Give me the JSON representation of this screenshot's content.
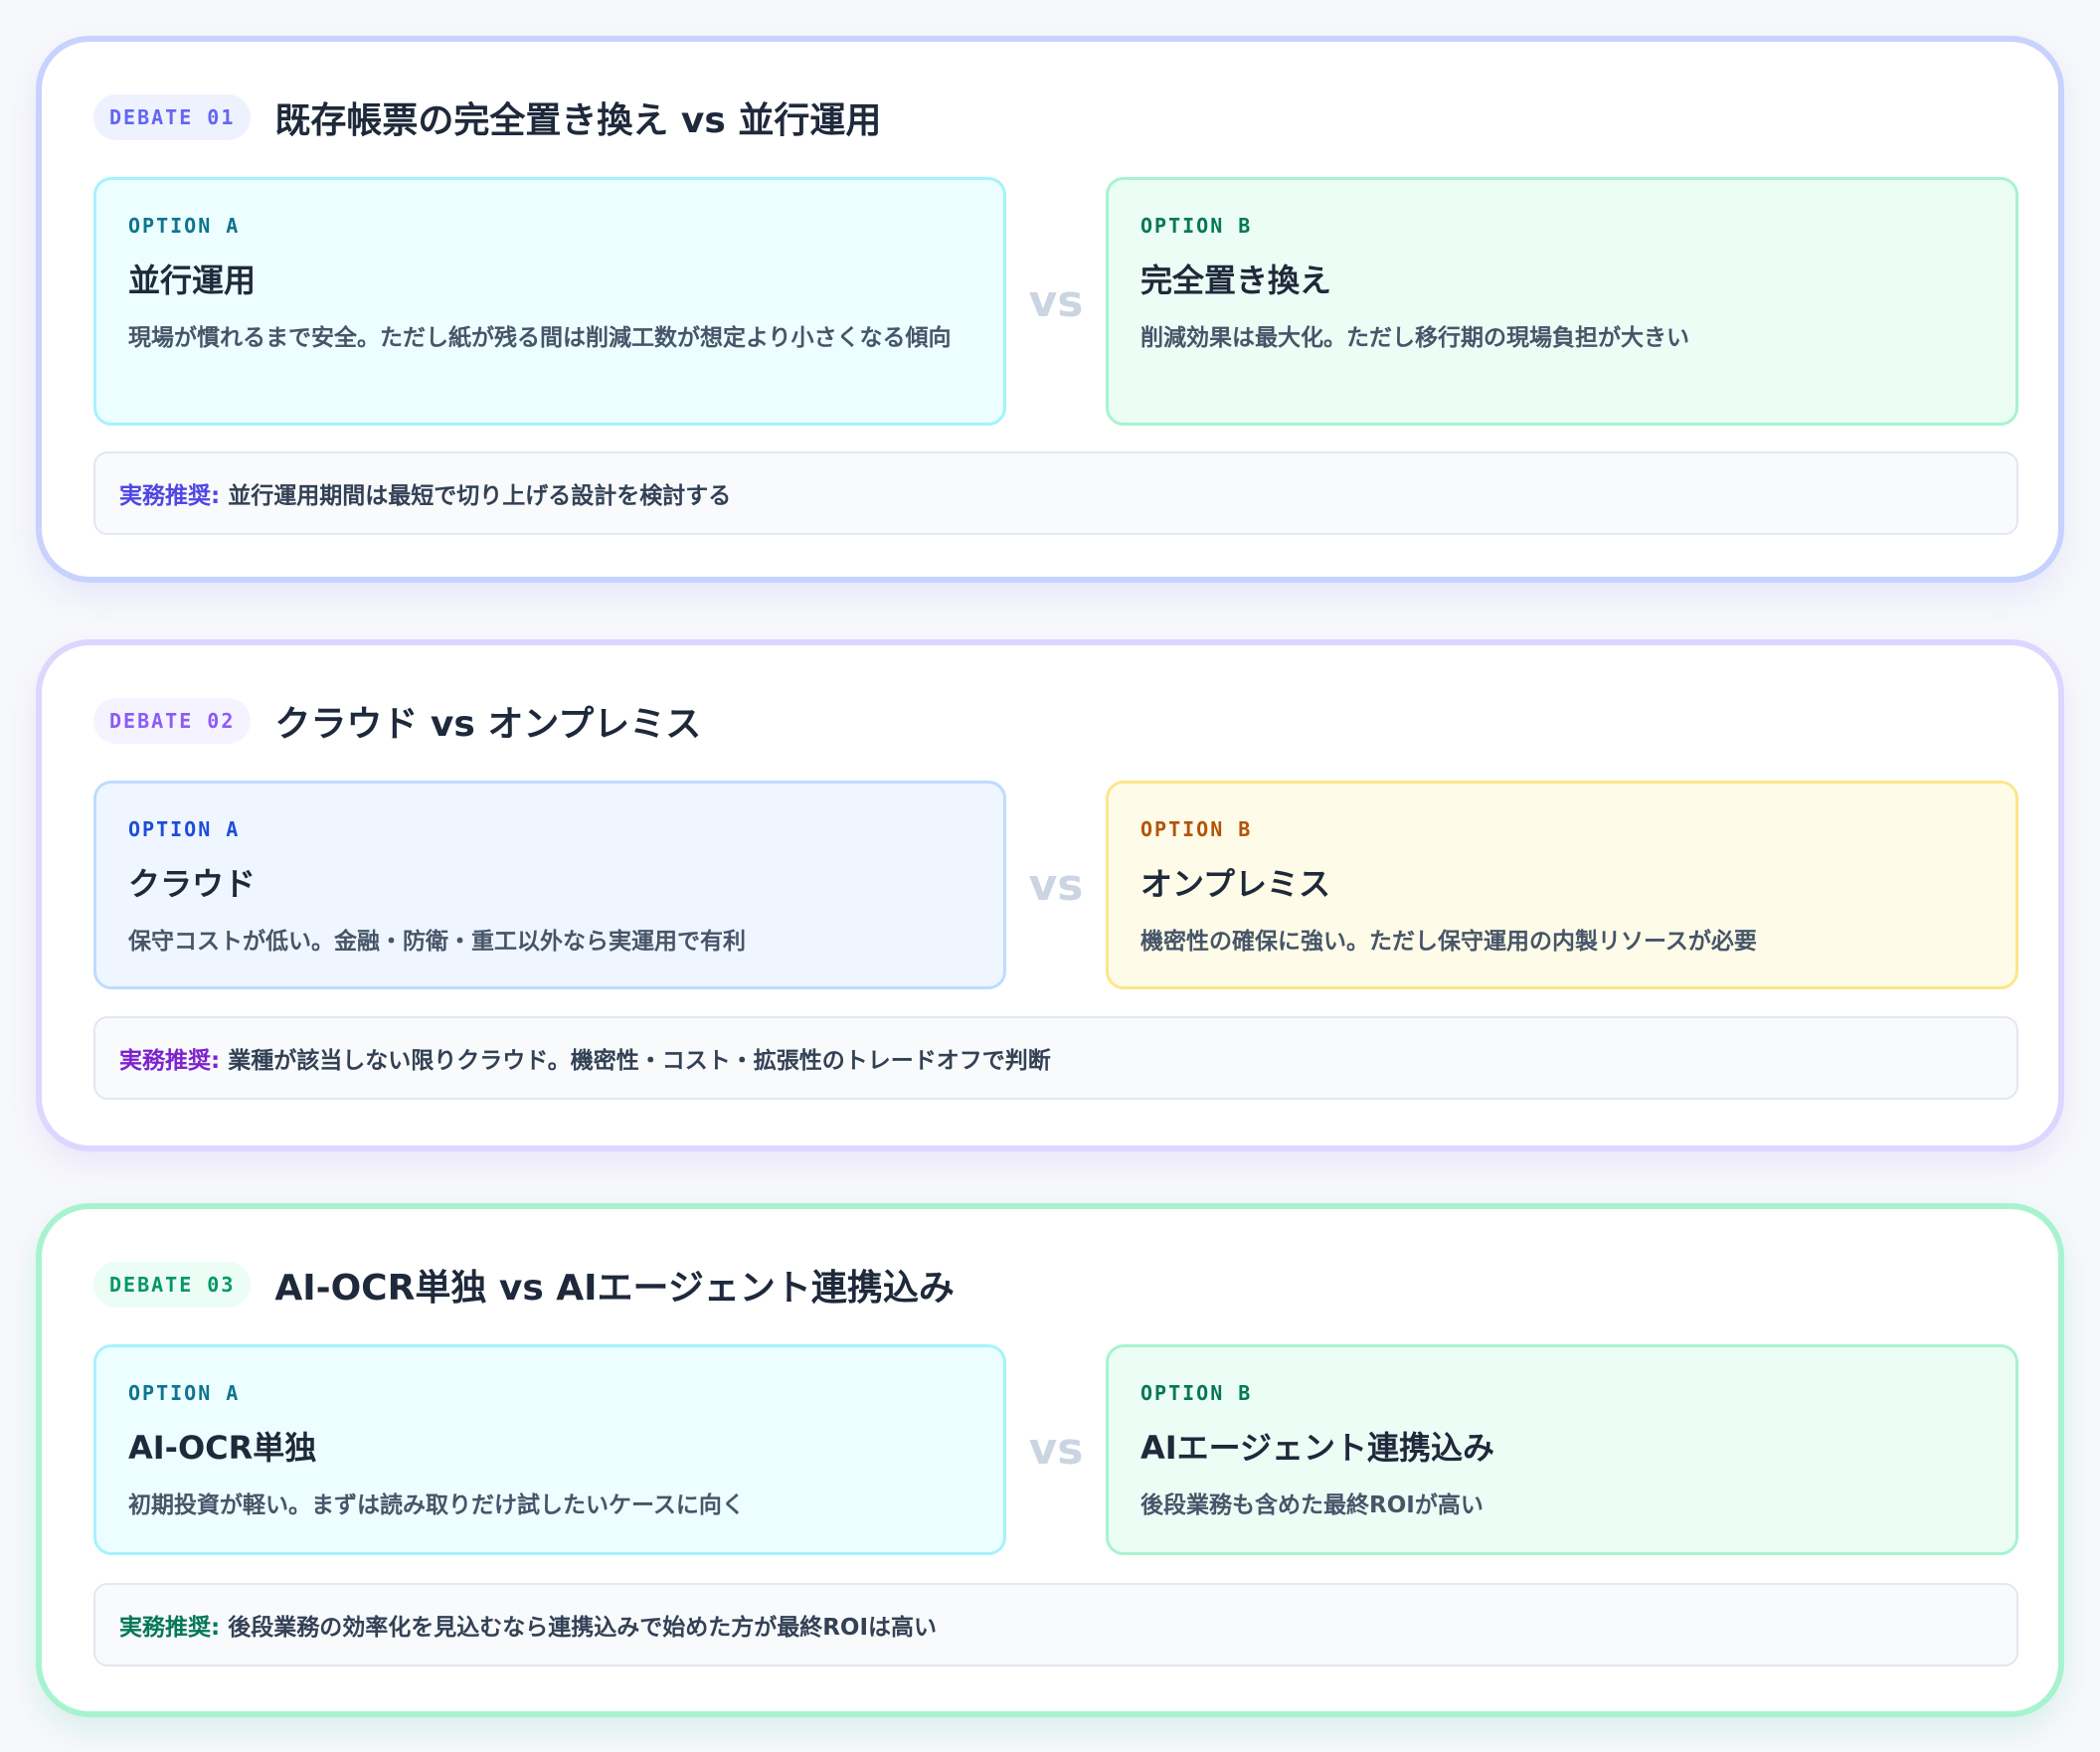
{
  "debates": [
    {
      "badge": "DEBATE 01",
      "title": "既存帳票の完全置き換え vs 並行運用",
      "option_a": {
        "label": "OPTION A",
        "title": "並行運用",
        "desc": "現場が慣れるまで安全。ただし紙が残る間は削減工数が想定より小さくなる傾向"
      },
      "vs": "vs",
      "option_b": {
        "label": "OPTION B",
        "title": "完全置き換え",
        "desc": "削減効果は最大化。ただし移行期の現場負担が大きい"
      },
      "recommendation_label": "実務推奨:",
      "recommendation": "並行運用期間は最短で切り上げる設計を検討する"
    },
    {
      "badge": "DEBATE 02",
      "title": "クラウド vs オンプレミス",
      "option_a": {
        "label": "OPTION A",
        "title": "クラウド",
        "desc": "保守コストが低い。金融・防衛・重工以外なら実運用で有利"
      },
      "vs": "vs",
      "option_b": {
        "label": "OPTION B",
        "title": "オンプレミス",
        "desc": "機密性の確保に強い。ただし保守運用の内製リソースが必要"
      },
      "recommendation_label": "実務推奨:",
      "recommendation": "業種が該当しない限りクラウド。機密性・コスト・拡張性のトレードオフで判断"
    },
    {
      "badge": "DEBATE 03",
      "title": "AI-OCR単独 vs AIエージェント連携込み",
      "option_a": {
        "label": "OPTION A",
        "title": "AI-OCR単独",
        "desc": "初期投資が軽い。まずは読み取りだけ試したいケースに向く"
      },
      "vs": "vs",
      "option_b": {
        "label": "OPTION B",
        "title": "AIエージェント連携込み",
        "desc": "後段業務も含めた最終ROIが高い"
      },
      "recommendation_label": "実務推奨:",
      "recommendation": "後段業務の効率化を見込むなら連携込みで始めた方が最終ROIは高い"
    }
  ],
  "colors": {
    "debate_01": {
      "border": "#c7d2fe",
      "badge_bg": "#eef2ff",
      "badge_text": "#6366f1",
      "opt_a_bg": "#ecfeff",
      "opt_a_border": "#a5f3fc",
      "opt_a_label": "#0e7490",
      "opt_b_bg": "#ecfdf5",
      "opt_b_border": "#a7f3d0",
      "opt_b_label": "#047857",
      "rec_label": "#4f46e5"
    },
    "debate_02": {
      "border": "#ddd6fe",
      "badge_bg": "#f5f3ff",
      "badge_text": "#8b5cf6",
      "opt_a_bg": "#eff6ff",
      "opt_a_border": "#bfdbfe",
      "opt_a_label": "#1d4ed8",
      "opt_b_bg": "#fefce8",
      "opt_b_border": "#fde68a",
      "opt_b_label": "#b45309",
      "rec_label": "#7e22ce"
    },
    "debate_03": {
      "border": "#a7f3d0",
      "badge_bg": "#ecfdf5",
      "badge_text": "#059669",
      "opt_a_bg": "#ecfeff",
      "opt_a_border": "#a5f3fc",
      "opt_a_label": "#0e7490",
      "opt_b_bg": "#ecfdf5",
      "opt_b_border": "#a7f3d0",
      "opt_b_label": "#047857",
      "rec_label": "#047857"
    }
  }
}
